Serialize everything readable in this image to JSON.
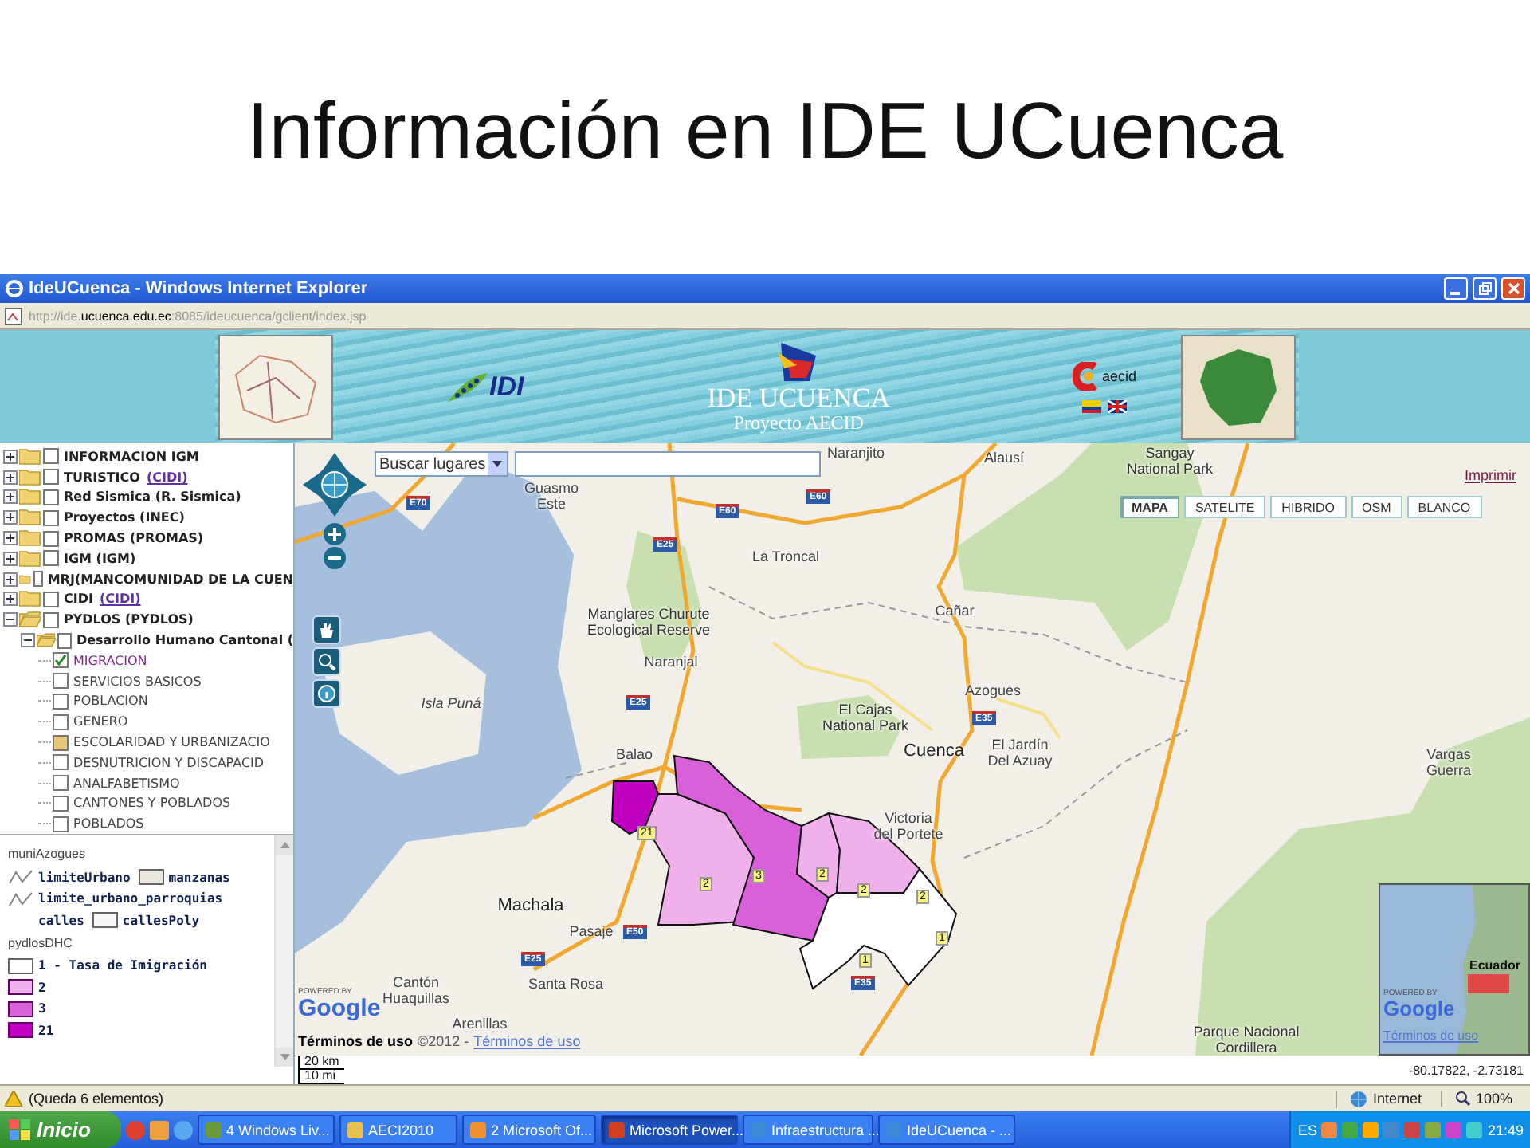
{
  "slide": {
    "title": "Información en IDE UCuenca"
  },
  "window": {
    "title": "IdeUCuenca - Windows Internet Explorer",
    "address": "http://ide.**ucuenca.edu.ec**:8085/ideucuenca/gclient/index.jsp"
  },
  "banner": {
    "idi_logo": "IDI",
    "title": "IDE UCUENCA",
    "subtitle": "Proyecto AECID",
    "aecid_logo": "aecid"
  },
  "layer_tree": [
    {
      "kind": "folder",
      "label": "INFORMACION IGM",
      "expanded": false,
      "checked": false
    },
    {
      "kind": "folder",
      "label": "TURISTICO",
      "link": "(CIDI)",
      "expanded": false,
      "checked": false
    },
    {
      "kind": "folder",
      "label": "Red Sismica (R. Sismica)",
      "expanded": false,
      "checked": false
    },
    {
      "kind": "folder",
      "label": "Proyectos (INEC)",
      "expanded": false,
      "checked": false
    },
    {
      "kind": "folder",
      "label": "PROMAS (PROMAS)",
      "expanded": false,
      "checked": false
    },
    {
      "kind": "folder",
      "label": "IGM (IGM)",
      "expanded": false,
      "checked": false
    },
    {
      "kind": "folder",
      "label": "MRJ(MANCOMUNIDAD DE LA CUEN",
      "expanded": false,
      "checked": false
    },
    {
      "kind": "folder",
      "label": "CIDI",
      "link": "(CIDI)",
      "expanded": false,
      "checked": false
    },
    {
      "kind": "folder",
      "label": "PYDLOS (PYDLOS)",
      "expanded": true,
      "checked": false,
      "children": [
        {
          "kind": "folder",
          "label": "Desarrollo Humano Cantonal (",
          "expanded": true,
          "checked": false,
          "children": [
            {
              "kind": "layer",
              "label": "MIGRACION",
              "checked": true,
              "partial": false
            },
            {
              "kind": "layer",
              "label": "SERVICIOS BASICOS",
              "checked": false,
              "partial": false
            },
            {
              "kind": "layer",
              "label": "POBLACION",
              "checked": false,
              "partial": false
            },
            {
              "kind": "layer",
              "label": "GENERO",
              "checked": false,
              "partial": false
            },
            {
              "kind": "layer",
              "label": "ESCOLARIDAD Y URBANIZACIO",
              "checked": false,
              "partial": true
            },
            {
              "kind": "layer",
              "label": "DESNUTRICION Y DISCAPACID",
              "checked": false,
              "partial": false
            },
            {
              "kind": "layer",
              "label": "ANALFABETISMO",
              "checked": false,
              "partial": false
            },
            {
              "kind": "layer",
              "label": "CANTONES Y POBLADOS",
              "checked": false,
              "partial": false
            },
            {
              "kind": "layer",
              "label": "POBLADOS",
              "checked": false,
              "partial": false
            }
          ]
        }
      ]
    }
  ],
  "legend": [
    {
      "title": "muniAzogues",
      "rows": [
        [
          {
            "kind": "line",
            "label": "limiteUrbano"
          },
          {
            "kind": "fill",
            "label": "manzanas",
            "color": "#ece8e0"
          }
        ],
        [
          {
            "kind": "line",
            "label": "limite_urbano_parroquias"
          }
        ],
        [
          {
            "kind": "none",
            "label": "calles"
          },
          {
            "kind": "fill",
            "label": "callesPoly",
            "color": "#f8f8f8"
          }
        ]
      ]
    },
    {
      "title": "pydlosDHC",
      "rows": [
        [
          {
            "kind": "fill",
            "label": "1 - Tasa de Imigración",
            "color": "#ffffff"
          }
        ],
        [
          {
            "kind": "fill",
            "label": "2",
            "color": "#f0b0ec"
          }
        ],
        [
          {
            "kind": "fill",
            "label": "3",
            "color": "#d860d8"
          }
        ],
        [
          {
            "kind": "fill",
            "label": "21",
            "color": "#c000c0"
          }
        ]
      ]
    }
  ],
  "map": {
    "search": {
      "select": "Buscar lugares"
    },
    "print_link": "Imprimir",
    "map_types": [
      {
        "label": "MAPA",
        "selected": true
      },
      {
        "label": "SATELITE",
        "selected": false
      },
      {
        "label": "HIBRIDO",
        "selected": false
      },
      {
        "label": "OSM",
        "selected": false
      },
      {
        "label": "BLANCO",
        "selected": false
      }
    ],
    "places": [
      {
        "kind": "town",
        "label": "Naranjito"
      },
      {
        "kind": "town",
        "label": "Alausí"
      },
      {
        "kind": "park",
        "label": "Sangay\nNational Park"
      },
      {
        "kind": "town",
        "label": "Guasmo\nEste"
      },
      {
        "kind": "town",
        "label": "La Troncal"
      },
      {
        "kind": "park",
        "label": "Manglares Churute\nEcological Reserve"
      },
      {
        "kind": "town",
        "label": "Cañar"
      },
      {
        "kind": "town",
        "label": "Naranjal"
      },
      {
        "kind": "island",
        "label": "Isla Puná"
      },
      {
        "kind": "park",
        "label": "El Cajas\nNational Park"
      },
      {
        "kind": "town",
        "label": "Azogues"
      },
      {
        "kind": "town",
        "label": "Balao"
      },
      {
        "kind": "city",
        "label": "Cuenca"
      },
      {
        "kind": "town",
        "label": "El Jardín\nDel Azuay"
      },
      {
        "kind": "town",
        "label": "Vargas\nGuerra"
      },
      {
        "kind": "town",
        "label": "Victoria\ndel Portete"
      },
      {
        "kind": "city",
        "label": "Machala"
      },
      {
        "kind": "town",
        "label": "Pasaje"
      },
      {
        "kind": "town",
        "label": "Cantón\nHuaquillas"
      },
      {
        "kind": "town",
        "label": "Santa Rosa"
      },
      {
        "kind": "town",
        "label": "Arenillas"
      },
      {
        "kind": "park",
        "label": "Parque Nacional\nCordillera"
      }
    ],
    "road_shields": [
      "E70",
      "E60",
      "E60",
      "E25",
      "E25",
      "E35",
      "E25",
      "E50",
      "E35"
    ],
    "regions": [
      {
        "color": "#c000c0"
      },
      {
        "color": "#f0b0ec"
      },
      {
        "color": "#d860d8"
      },
      {
        "color": "#f0b0ec"
      },
      {
        "color": "#f0b0ec"
      },
      {
        "color": "#ffffff"
      }
    ],
    "region_labels": [
      "21",
      "2",
      "3",
      "2",
      "2",
      "2",
      "1",
      "1"
    ],
    "powered_by": "POWERED BY",
    "google": "Google",
    "terms_overlay": "Términos de uso",
    "copyright": "©2012 -",
    "terms_link": "Términos de uso",
    "scale": [
      "20 km",
      "10 mi"
    ],
    "overview": {
      "label": "Ecuador",
      "powered_by": "POWERED BY",
      "google": "Google",
      "terms_link": "Términos de uso"
    },
    "coordinates": "-80.17822, -2.73181"
  },
  "status_bar": {
    "message": "(Queda 6 elementos)",
    "zone": "Internet",
    "zoom": "100%"
  },
  "taskbar": {
    "start": "Inicio",
    "tasks": [
      {
        "label": "4 Windows Liv...",
        "selected": false
      },
      {
        "label": "AECI2010",
        "selected": false
      },
      {
        "label": "2 Microsoft Of...",
        "selected": false
      },
      {
        "label": "Microsoft Power...",
        "selected": true
      },
      {
        "label": "Infraestructura ...",
        "selected": false
      },
      {
        "label": "IdeUCuenca - ...",
        "selected": false
      }
    ],
    "language": "ES",
    "clock": "21:49"
  }
}
